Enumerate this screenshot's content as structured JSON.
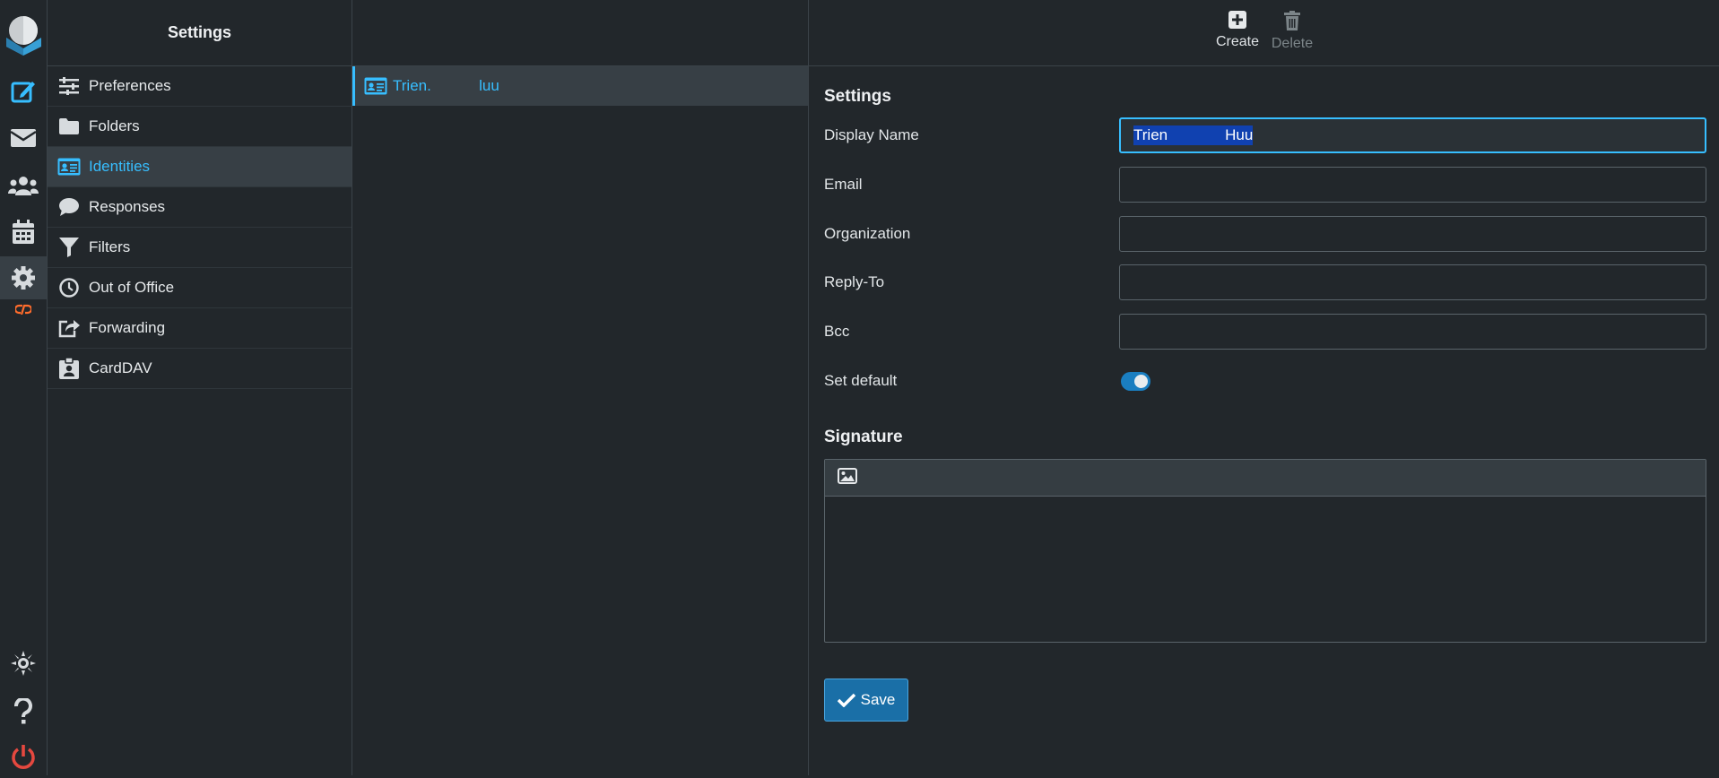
{
  "rail": {
    "items": [
      {
        "icon": "compose-icon",
        "active": false
      },
      {
        "icon": "mail-icon",
        "active": false
      },
      {
        "icon": "contacts-icon",
        "active": false
      },
      {
        "icon": "calendar-icon",
        "active": false
      },
      {
        "icon": "gear-icon",
        "active": true
      },
      {
        "icon": "cpanel-icon",
        "active": false
      }
    ],
    "bottom": [
      {
        "icon": "theme-icon"
      },
      {
        "icon": "help-icon"
      },
      {
        "icon": "logout-icon"
      }
    ]
  },
  "nav": {
    "title": "Settings",
    "items": [
      {
        "label": "Preferences",
        "icon": "sliders-icon"
      },
      {
        "label": "Folders",
        "icon": "folder-icon"
      },
      {
        "label": "Identities",
        "icon": "id-card-icon",
        "active": true
      },
      {
        "label": "Responses",
        "icon": "chat-bubble-icon"
      },
      {
        "label": "Filters",
        "icon": "funnel-icon"
      },
      {
        "label": "Out of Office",
        "icon": "clock-icon"
      },
      {
        "label": "Forwarding",
        "icon": "share-icon"
      },
      {
        "label": "CardDAV",
        "icon": "contact-badge-icon"
      }
    ]
  },
  "identities": {
    "items": [
      {
        "name_first": "Trien",
        "name_mid": " .",
        "name_last": "luu"
      }
    ]
  },
  "toolbar": {
    "create_label": "Create",
    "delete_label": "Delete"
  },
  "form": {
    "section_title": "Settings",
    "fields": {
      "display_name": {
        "label": "Display Name",
        "value_first": "Trien",
        "value_last": "Huu"
      },
      "email": {
        "label": "Email",
        "value": ""
      },
      "organization": {
        "label": "Organization",
        "value": ""
      },
      "reply_to": {
        "label": "Reply-To",
        "value": ""
      },
      "bcc": {
        "label": "Bcc",
        "value": ""
      },
      "set_default": {
        "label": "Set default",
        "checked": true
      }
    },
    "signature_title": "Signature",
    "save_label": "Save"
  },
  "colors": {
    "accent": "#37beff",
    "background": "#22272b",
    "active_row": "#373f45",
    "save_button": "#1a6fa7",
    "logout": "#e5483f",
    "cpanel": "#ff6c2c"
  }
}
